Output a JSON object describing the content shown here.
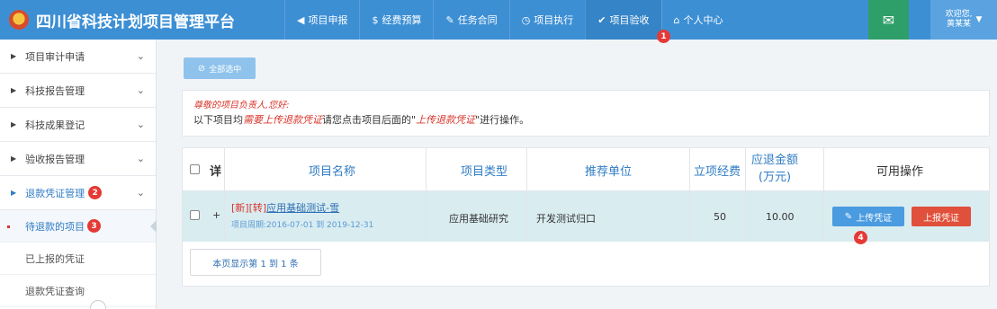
{
  "header": {
    "title": "四川省科技计划项目管理平台",
    "nav": [
      {
        "icon": "send-icon",
        "glyph": "◀",
        "label": "项目申报"
      },
      {
        "icon": "dollar-icon",
        "glyph": "$",
        "label": "经费预算"
      },
      {
        "icon": "pencil-icon",
        "glyph": "✎",
        "label": "任务合同"
      },
      {
        "icon": "clock-icon",
        "glyph": "◷",
        "label": "项目执行"
      },
      {
        "icon": "check-icon",
        "glyph": "✔",
        "label": "项目验收"
      },
      {
        "icon": "home-icon",
        "glyph": "⌂",
        "label": "个人中心"
      }
    ],
    "nav_badge": "1",
    "user_greeting": "欢迎您,",
    "user_name": "黄某某",
    "mail_glyph": "✉"
  },
  "sidebar": {
    "items": [
      {
        "label": "项目审计申请"
      },
      {
        "label": "科技报告管理"
      },
      {
        "label": "科技成果登记"
      },
      {
        "label": "验收报告管理"
      },
      {
        "label": "退款凭证管理",
        "badge": "2"
      }
    ],
    "sub_items": [
      {
        "label": "待退款的项目",
        "badge": "3"
      },
      {
        "label": "已上报的凭证"
      },
      {
        "label": "退款凭证查询"
      }
    ]
  },
  "main": {
    "select_all_label": "全部选中",
    "notice_greeting": "尊敬的项目负责人,您好:",
    "notice_prefix": "以下项目均",
    "notice_red1": "需要上传退款凭证",
    "notice_mid": "请您点击项目后面的\"",
    "notice_red2": "上传退款凭证",
    "notice_suffix": "\"进行操作。",
    "table": {
      "headers": {
        "detail": "详",
        "name": "项目名称",
        "type": "项目类型",
        "unit": "推荐单位",
        "funding": "立项经费",
        "refund_line1": "应退金额",
        "refund_line2": "(万元)",
        "actions": "可用操作"
      },
      "row": {
        "expand": "+",
        "tags": "[新][转]",
        "name": "应用基础测试-雪",
        "period": "项目周期:2016-07-01 到 2019-12-31",
        "type": "应用基础研究",
        "unit": "开发测试归口",
        "funding": "50",
        "refund": "10.00",
        "upload_label": "上传凭证",
        "report_label": "上报凭证",
        "action_badge": "4"
      }
    },
    "pager": "本页显示第 1 到 1 条"
  }
}
